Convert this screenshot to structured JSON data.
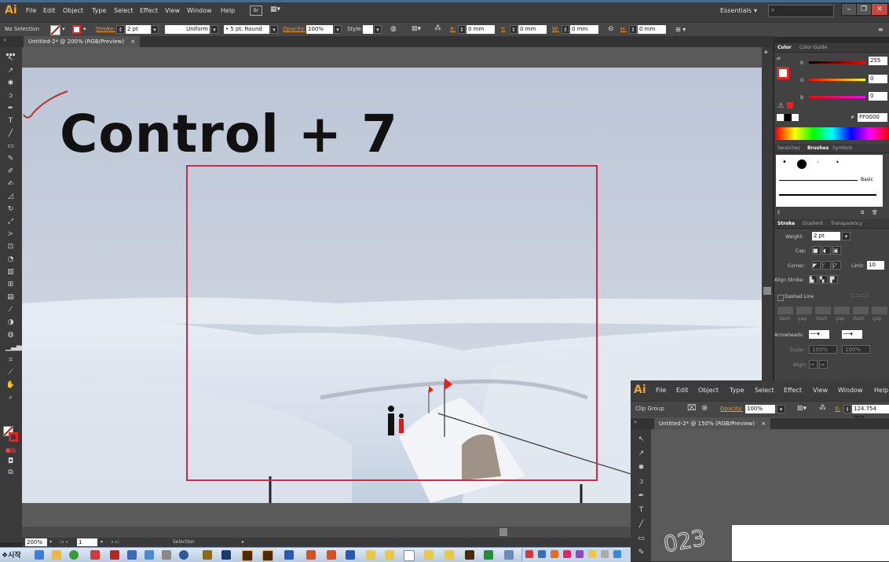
{
  "app": {
    "logo": "Ai",
    "menus": [
      "File",
      "Edit",
      "Object",
      "Type",
      "Select",
      "Effect",
      "View",
      "Window",
      "Help"
    ],
    "workspace": "Essentials",
    "workspace_arrow": "▾",
    "search_placeholder": ""
  },
  "control_bar": {
    "selection": "No Selection",
    "stroke_label": "Stroke:",
    "stroke_value": "2 pt",
    "profile": "Uniform",
    "brush": "5 pt. Round",
    "opacity_label": "Opacity:",
    "opacity_value": "100%",
    "style_label": "Style:",
    "x_label": "X:",
    "x_value": "0 mm",
    "y_label": "Y:",
    "y_value": "0 mm",
    "w_label": "W:",
    "w_value": "0 mm",
    "h_label": "H:",
    "h_value": "0 mm"
  },
  "document": {
    "tab": "Untitled-2* @ 200% (RGB/Preview)",
    "tab_close": "×",
    "heading": "Control + 7"
  },
  "status": {
    "zoom": "200%",
    "page": "1",
    "tool": "Selection"
  },
  "color_panel": {
    "tabs": [
      "Color",
      "Color Guide"
    ],
    "r_label": "R",
    "r_value": "255",
    "g_label": "G",
    "g_value": "0",
    "b_label": "B",
    "b_value": "0",
    "hash": "#",
    "hex": "FF0000"
  },
  "brushes_panel": {
    "tabs": [
      "Swatches",
      "Brushes",
      "Symbols"
    ],
    "basic": "Basic"
  },
  "stroke_panel": {
    "tabs": [
      "Stroke",
      "Gradient",
      "Transparency"
    ],
    "weight_label": "Weight:",
    "weight_value": "2 pt",
    "cap_label": "Cap:",
    "corner_label": "Corner:",
    "limit_label": "Limit:",
    "limit_value": "10",
    "align_label": "Align Stroke:",
    "dashed_label": "Dashed Line",
    "dash_labels": [
      "dash",
      "gap",
      "dash",
      "gap",
      "dash",
      "gap"
    ],
    "arrowheads_label": "Arrowheads:",
    "scale_label": "Scale:",
    "scale_value1": "100%",
    "scale_value2": "100%",
    "align2_label": "Align:"
  },
  "second_window": {
    "logo": "Ai",
    "menus": [
      "File",
      "Edit",
      "Object",
      "Type",
      "Select",
      "Effect",
      "View",
      "Window",
      "Help"
    ],
    "selection": "Clip Group",
    "opacity_label": "Opacity:",
    "opacity_value": "100%",
    "x_label": "X:",
    "x_value": "124.754 mm",
    "tab": "Untitled-2* @ 150% (RGB/Preview)",
    "tab_close": "×",
    "canvas_text": "023"
  },
  "taskbar": {
    "start_label": "시작"
  },
  "colors": {
    "accent_red": "#d02a4a",
    "ai_orange": "#e8a33a"
  }
}
